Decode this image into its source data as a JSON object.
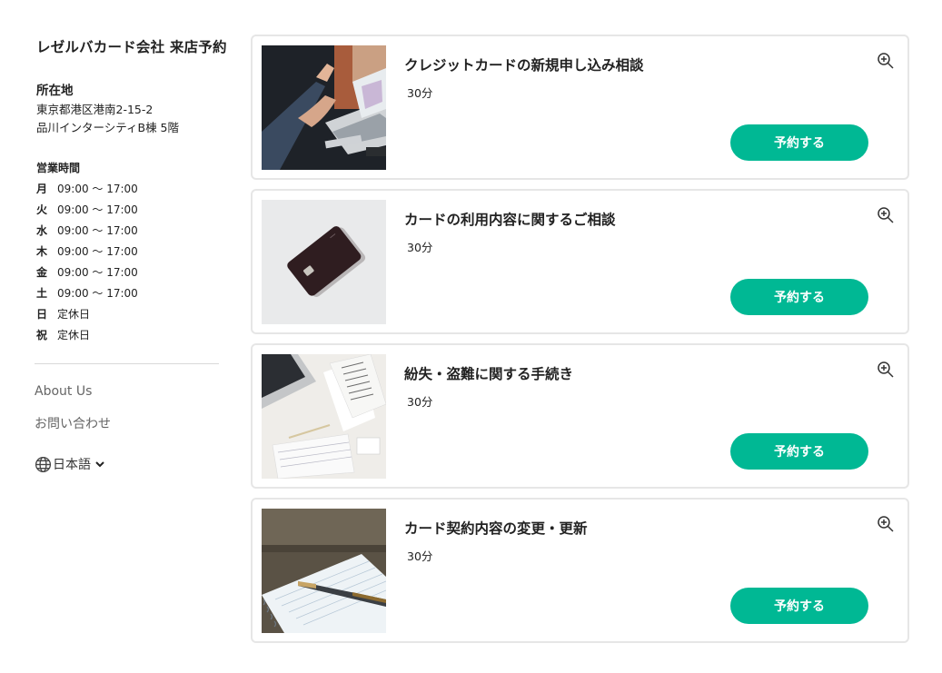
{
  "store": {
    "title": "レゼルバカード会社 来店予約",
    "location_heading": "所在地",
    "address_line1": "東京都港区港南2-15-2",
    "address_line2": "品川インターシティB棟 5階",
    "hours_heading": "営業時間",
    "hours": [
      {
        "day": "月",
        "time": "09:00 〜 17:00"
      },
      {
        "day": "火",
        "time": "09:00 〜 17:00"
      },
      {
        "day": "水",
        "time": "09:00 〜 17:00"
      },
      {
        "day": "木",
        "time": "09:00 〜 17:00"
      },
      {
        "day": "金",
        "time": "09:00 〜 17:00"
      },
      {
        "day": "土",
        "time": "09:00 〜 17:00"
      },
      {
        "day": "日",
        "time": "定休日"
      },
      {
        "day": "祝",
        "time": "定休日"
      }
    ]
  },
  "links": {
    "about": "About Us",
    "contact": "お問い合わせ"
  },
  "language": {
    "label": "日本語",
    "icon": "globe-icon"
  },
  "services": [
    {
      "title": "クレジットカードの新規申し込み相談",
      "duration": "30分",
      "button": "予約する",
      "image": "laptop-meeting-photo"
    },
    {
      "title": "カードの利用内容に関するご相談",
      "duration": "30分",
      "button": "予約する",
      "image": "black-card-photo"
    },
    {
      "title": "紛失・盗難に関する手続き",
      "duration": "30分",
      "button": "予約する",
      "image": "receipts-desk-photo"
    },
    {
      "title": "カード契約内容の変更・更新",
      "duration": "30分",
      "button": "予約する",
      "image": "notebook-pen-photo"
    }
  ],
  "colors": {
    "accent": "#00b894",
    "border": "#e6e6e6",
    "muted_text": "#666666"
  }
}
